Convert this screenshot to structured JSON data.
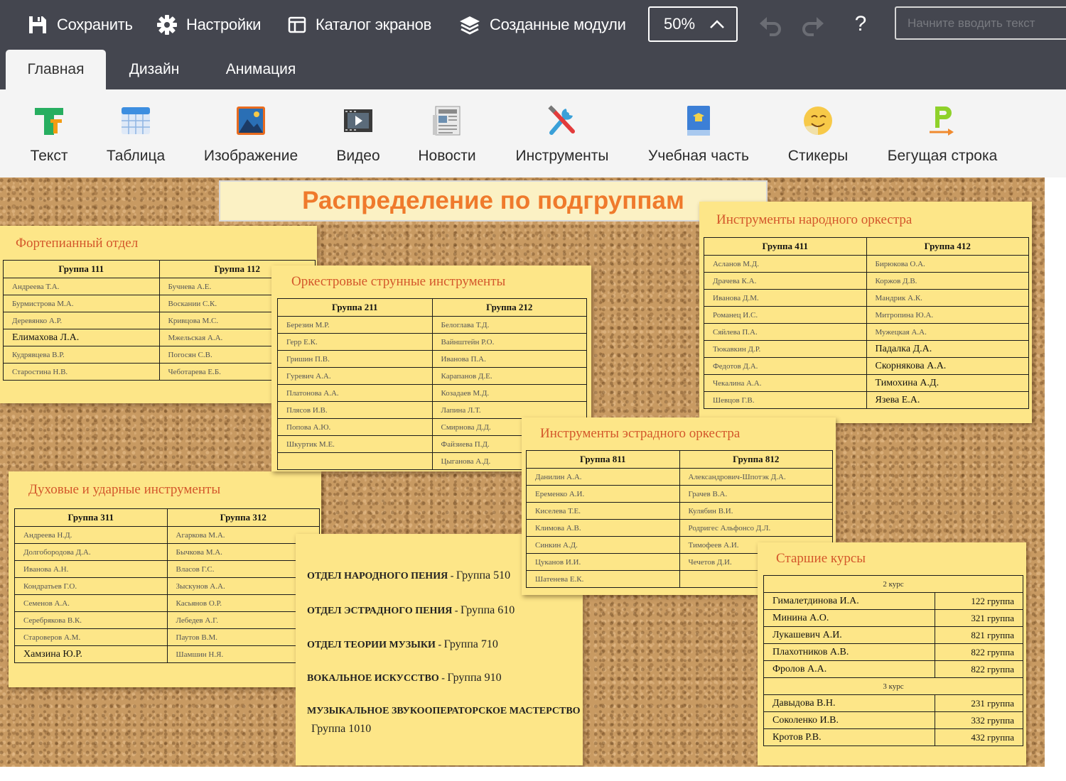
{
  "toolbar": {
    "save": "Сохранить",
    "settings": "Настройки",
    "catalog": "Каталог экранов",
    "modules": "Созданные модули",
    "zoom": "50%",
    "help": "?",
    "search_placeholder": "Начните вводить текст"
  },
  "tabs": [
    "Главная",
    "Дизайн",
    "Анимация"
  ],
  "ribbon": [
    "Текст",
    "Таблица",
    "Изображение",
    "Видео",
    "Новости",
    "Инструменты",
    "Учебная часть",
    "Стикеры",
    "Бегущая строка"
  ],
  "board": {
    "title": "Распределение по подгруппам",
    "piano": {
      "title": "Фортепианный отдел",
      "headers": [
        "Группа   111",
        "Группа   112"
      ],
      "rows": [
        [
          "Андреева Т.А.",
          "Бучнева А.Е."
        ],
        [
          "Бурмистрова М.А.",
          "Воскании С.К."
        ],
        [
          "Деревянко А.Р.",
          "Кривцова М.С."
        ],
        [
          "Елимахова Л.А.",
          "Мжельская А.А."
        ],
        [
          "Кудрявцева В.Р.",
          "Погосян С.В."
        ],
        [
          "Старостина Н.В.",
          "Чеботарева Е.Б."
        ]
      ]
    },
    "strings": {
      "title": "Оркестровые струнные инструменты",
      "headers": [
        "Группа   211",
        "Группа   212"
      ],
      "rows": [
        [
          "Березин М.Р.",
          "Белоглава Т.Д."
        ],
        [
          "Герр Е.К.",
          "Вайнштейн Р.О."
        ],
        [
          "Гришин П.В.",
          "Иванова П.А."
        ],
        [
          "Гуревич А.А.",
          "Карапанов Д.Е."
        ],
        [
          "Платонова А.А.",
          "Козадаев М.Д."
        ],
        [
          "Плясов И.В.",
          "Лапина Л.Т."
        ],
        [
          "Попова А.Ю.",
          "Смирнова Д.Д."
        ],
        [
          "Шкуртик М.Е.",
          "Файзиева П.Д."
        ],
        [
          "",
          "Цыганова А.Д."
        ]
      ]
    },
    "folk": {
      "title": "Инструменты народного оркестра",
      "headers": [
        "Группа   411",
        "Группа   412"
      ],
      "rows": [
        [
          "Асланов М.Д.",
          "Бирюкова О.А."
        ],
        [
          "Драчева К.А.",
          "Коржов Д.В."
        ],
        [
          "Иванова Д.М.",
          "Мандрик А.К."
        ],
        [
          "Романец И.С.",
          "Митропина Ю.А."
        ],
        [
          "Сяйлева П.А.",
          "Мужецкая А.А."
        ],
        [
          "Тюкавкин Д.Р.",
          "Падалка Д.А."
        ],
        [
          "Федотов Д.А.",
          "Скорнякова А.А."
        ],
        [
          "Чекалина А.А.",
          "Тимохина А.Д."
        ],
        [
          "Шевцов Г.В.",
          "Язева Е.А."
        ]
      ]
    },
    "pop": {
      "title": "Инструменты эстрадного оркестра",
      "headers": [
        "Группа   811",
        "Группа   812"
      ],
      "rows": [
        [
          "Данилин А.А.",
          "Александрович-Шпотэк Д.А."
        ],
        [
          "Еременко А.И.",
          "Грачев В.А."
        ],
        [
          "Киселева Т.Е.",
          "Кулябин В.И."
        ],
        [
          "Климова А.В.",
          "Родригес Альфонсо Д.Л."
        ],
        [
          "Синкин А.Д.",
          "Тимофеев А.И."
        ],
        [
          "Цуканов И.И.",
          "Чечетов Д.И."
        ],
        [
          "Шатенева Е.К.",
          ""
        ]
      ]
    },
    "winds": {
      "title": "Духовые и ударные инструменты",
      "headers": [
        "Группа   311",
        "Группа   312"
      ],
      "rows": [
        [
          "Андреева Н.Д.",
          "Агаркова М.А."
        ],
        [
          "Долгобородова Д.А.",
          "Бычкова М.А."
        ],
        [
          "Иванова А.Н.",
          "Власов Г.С."
        ],
        [
          "Кондратьев Г.О.",
          "Зыскунов А.А."
        ],
        [
          "Семенов А.А.",
          "Касьянов О.Р."
        ],
        [
          "Серебрякова В.К.",
          "Лебедев А.Г."
        ],
        [
          "Староверов А.М.",
          "Паутов В.М."
        ],
        [
          "Хамзина Ю.Р.",
          "Шамшин Н.Я."
        ]
      ]
    },
    "depts": [
      {
        "name": "ОТДЕЛ НАРОДНОГО ПЕНИЯ - ",
        "group": "Группа  510"
      },
      {
        "name": "ОТДЕЛ ЭСТРАДНОГО ПЕНИЯ - ",
        "group": "Группа  610"
      },
      {
        "name": "ОТДЕЛ ТЕОРИИ МУЗЫКИ - ",
        "group": " Группа  710"
      },
      {
        "name": "ВОКАЛЬНОЕ ИСКУССТВО - ",
        "group": "Группа  910"
      },
      {
        "name": "МУЗЫКАЛЬНОЕ ЗВУКООПЕРАТОРСКОЕ МАСТЕРСТВО",
        "group": "Группа  1010"
      }
    ],
    "seniors": {
      "title": "Старшие курсы",
      "course2": "2 курс",
      "rows2": [
        [
          "Гималетдинова И.А.",
          "122 группа"
        ],
        [
          "Минина А.О.",
          "321 группа"
        ],
        [
          "Лукашевич А.И.",
          "821 группа"
        ],
        [
          "Плахотников А.В.",
          "822 группа"
        ],
        [
          "Фролов А.А.",
          "822 группа"
        ]
      ],
      "course3": "3 курс",
      "rows3": [
        [
          "Давыдова В.Н.",
          "231 группа"
        ],
        [
          "Соколенко И.В.",
          "332 группа"
        ],
        [
          "Кротов Р.В.",
          "432 группа"
        ]
      ]
    }
  }
}
